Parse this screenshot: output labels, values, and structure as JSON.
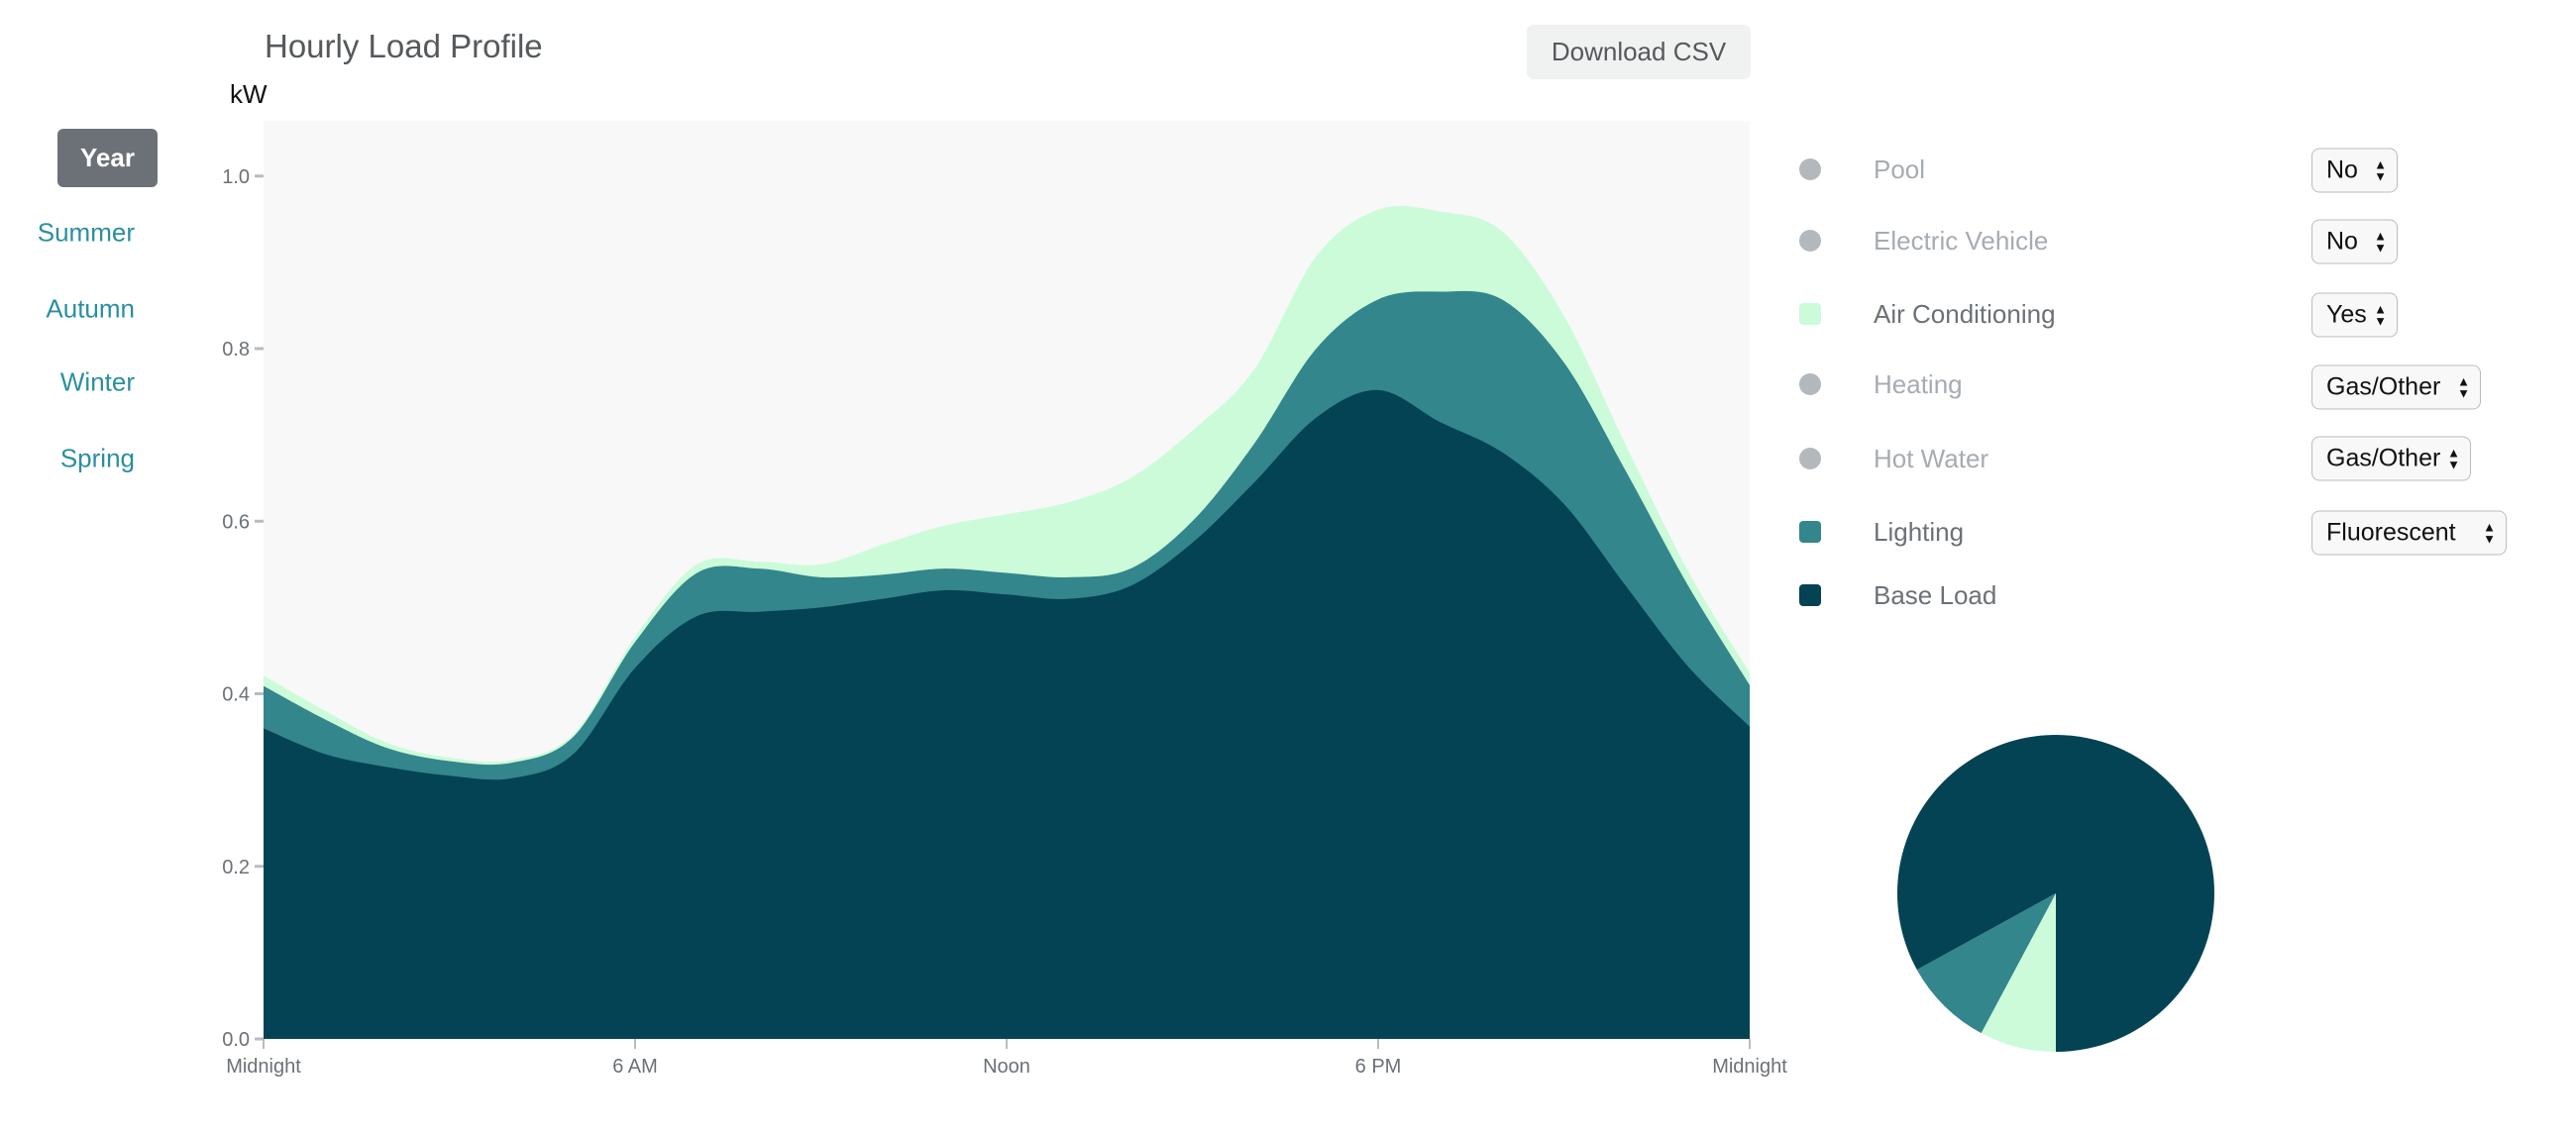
{
  "sidebar": {
    "items": [
      {
        "label": "Year",
        "active": true
      },
      {
        "label": "Summer",
        "active": false
      },
      {
        "label": "Autumn",
        "active": false
      },
      {
        "label": "Winter",
        "active": false
      },
      {
        "label": "Spring",
        "active": false
      }
    ]
  },
  "header": {
    "title": "Hourly Load Profile",
    "download_label": "Download CSV"
  },
  "legend": [
    {
      "label": "Pool",
      "active": false,
      "color": "#b3b8bc",
      "select_value": "No"
    },
    {
      "label": "Electric Vehicle",
      "active": false,
      "color": "#b3b8bc",
      "select_value": "No"
    },
    {
      "label": "Air Conditioning",
      "active": true,
      "color": "#ccfbd9",
      "select_value": "Yes"
    },
    {
      "label": "Heating",
      "active": false,
      "color": "#b3b8bc",
      "select_value": "Gas/Other"
    },
    {
      "label": "Hot Water",
      "active": false,
      "color": "#b3b8bc",
      "select_value": "Gas/Other"
    },
    {
      "label": "Lighting",
      "active": true,
      "color": "#33868b",
      "select_value": "Fluorescent"
    },
    {
      "label": "Base Load",
      "active": true,
      "color": "#044354",
      "select_value": null
    }
  ],
  "chart_data": [
    {
      "type": "area",
      "stacked": true,
      "title": "Hourly Load Profile",
      "ylabel": "kW",
      "xlabel": "",
      "ylim": [
        0,
        1.064
      ],
      "yticks": [
        0.0,
        0.2,
        0.4,
        0.6,
        0.8,
        1.0
      ],
      "ytick_labels": [
        "0.0",
        "0.2",
        "0.4",
        "0.6",
        "0.8",
        "1.0"
      ],
      "xlim": [
        0,
        24
      ],
      "xticks": [
        0,
        6,
        12,
        18,
        24
      ],
      "xtick_labels": [
        "Midnight",
        "6 AM",
        "Noon",
        "6 PM",
        "Midnight"
      ],
      "x": [
        0,
        1,
        2,
        3,
        4,
        5,
        6,
        7,
        8,
        9,
        10,
        11,
        12,
        13,
        14,
        15,
        16,
        17,
        18,
        19,
        20,
        21,
        22,
        23,
        24
      ],
      "series": [
        {
          "name": "Base Load",
          "color": "#044354",
          "values": [
            0.36,
            0.33,
            0.315,
            0.305,
            0.302,
            0.33,
            0.43,
            0.49,
            0.495,
            0.5,
            0.51,
            0.52,
            0.515,
            0.51,
            0.525,
            0.575,
            0.645,
            0.72,
            0.752,
            0.715,
            0.68,
            0.62,
            0.525,
            0.432,
            0.362
          ]
        },
        {
          "name": "Lighting",
          "color": "#33868b",
          "values": [
            0.049,
            0.04,
            0.022,
            0.017,
            0.018,
            0.02,
            0.03,
            0.05,
            0.05,
            0.035,
            0.028,
            0.025,
            0.025,
            0.025,
            0.02,
            0.025,
            0.045,
            0.08,
            0.105,
            0.151,
            0.177,
            0.164,
            0.133,
            0.094,
            0.048
          ]
        },
        {
          "name": "Air Conditioning",
          "color": "#ccfbd9",
          "values": [
            0.012,
            0.01,
            0.006,
            0.004,
            0.003,
            0.003,
            0.006,
            0.01,
            0.008,
            0.015,
            0.035,
            0.05,
            0.068,
            0.087,
            0.105,
            0.105,
            0.086,
            0.107,
            0.104,
            0.093,
            0.079,
            0.054,
            0.03,
            0.017,
            0.014
          ]
        }
      ],
      "grid": false,
      "background": "#f8f8f8"
    },
    {
      "type": "pie",
      "title": "",
      "slices": [
        {
          "name": "Base Load",
          "value": 83.0,
          "color": "#044354"
        },
        {
          "name": "Air Conditioning",
          "value": 7.8,
          "color": "#ccfbd9"
        },
        {
          "name": "Lighting",
          "value": 9.2,
          "color": "#33868b"
        }
      ],
      "slice_order_note": "clockwise from 12 o'clock: Base Load (to 6 o'clock), Air Conditioning, Lighting, Base Load remainder"
    }
  ]
}
